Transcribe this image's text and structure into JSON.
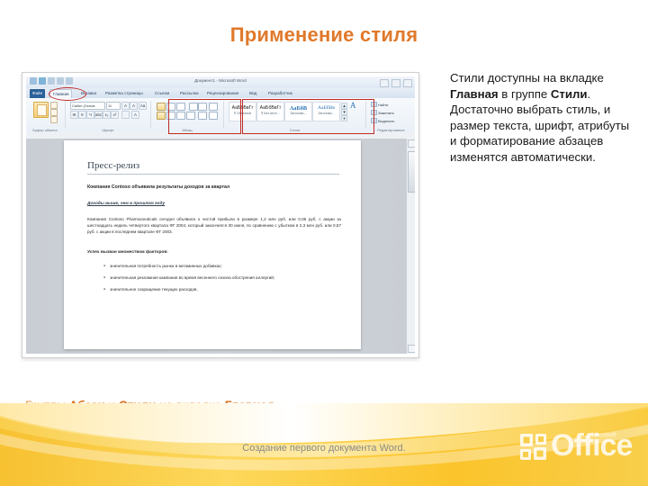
{
  "slide": {
    "title": "Применение стиля",
    "title_color": "#E0792B",
    "caption": {
      "parts": [
        {
          "text": "Группы ",
          "bold": false
        },
        {
          "text": "Абзац",
          "bold": true
        },
        {
          "text": " и ",
          "bold": false
        },
        {
          "text": "Стили",
          "bold": true
        },
        {
          "text": " на вкладке ",
          "bold": false
        },
        {
          "text": "Главная",
          "bold": true
        },
        {
          "text": ".",
          "bold": false
        }
      ],
      "color": "#E9A05A",
      "bold_color": "#D9701F"
    }
  },
  "explanation": {
    "parts": [
      {
        "text": "Стили доступны на вкладке ",
        "bold": false
      },
      {
        "text": "Главная",
        "bold": true
      },
      {
        "text": " в группе ",
        "bold": false
      },
      {
        "text": "Стили",
        "bold": true
      },
      {
        "text": ". Достаточно выбрать стиль, и размер текста, шрифт, атрибуты и форматирование абзацев изменятся автоматически.",
        "bold": false
      }
    ]
  },
  "screenshot": {
    "window": {
      "document_title": "Документ1 - Microsoft Word",
      "quick_access": [
        "save-icon",
        "undo-icon",
        "redo-icon",
        "customize-icon"
      ],
      "window_controls": [
        "minimize",
        "restore",
        "close"
      ]
    },
    "ribbon": {
      "tabs": [
        {
          "label": "Файл",
          "state": "file"
        },
        {
          "label": "Главная",
          "state": "active"
        },
        {
          "label": "Вставка",
          "state": "normal"
        },
        {
          "label": "Разметка страницы",
          "state": "normal"
        },
        {
          "label": "Ссылки",
          "state": "normal"
        },
        {
          "label": "Рассылки",
          "state": "normal"
        },
        {
          "label": "Рецензирование",
          "state": "normal"
        },
        {
          "label": "Вид",
          "state": "normal"
        },
        {
          "label": "Разработчик",
          "state": "normal"
        }
      ],
      "groups": [
        {
          "name": "Буфер обмена",
          "label": "Буфер обмена"
        },
        {
          "name": "Шрифт",
          "label": "Шрифт"
        },
        {
          "name": "Абзац",
          "label": "Абзац"
        },
        {
          "name": "Стили",
          "label": "Стили"
        },
        {
          "name": "Редактирование",
          "label": "Редактирование"
        }
      ],
      "clipboard": {
        "paste_label": "Вставить"
      },
      "font": {
        "font_name": "Calibri (Основ",
        "font_size": "11",
        "buttons": [
          "Ж",
          "К",
          "Ч",
          "abc",
          "x₂",
          "x²",
          "A",
          "A"
        ]
      },
      "styles_gallery": [
        {
          "sample": "АаБбВвГг",
          "name": "¶ Обычный",
          "kind": "n"
        },
        {
          "sample": "АаБбВвГг",
          "name": "¶ Без инте...",
          "kind": "n"
        },
        {
          "sample": "АаБбВ",
          "name": "Заголово...",
          "kind": "h1"
        },
        {
          "sample": "АаБбВв",
          "name": "Заголово...",
          "kind": "h2"
        }
      ],
      "change_styles": "Изменить стили",
      "editing": [
        "Найти",
        "Заменить",
        "Выделить"
      ]
    },
    "document": {
      "heading": "Пресс-релиз",
      "subtitle": "Компания Contoso объявила результаты доходов за квартал",
      "section_heading": "Доходы выше, чем в прошлом году",
      "body": "Компания Contoso Pharmaceuticals сегодня объявила о чистой прибыли в размере 1,2 млн руб. или 0,06 руб. с акции за шестнадцать недель четвертого квартала ФГ 2004, который закончился 30 июня, по сравнению с убытком в 2,3 млн руб. или 0,57 руб. с акции в последнем квартале ФГ 2003.",
      "lead_in": "Успех вызван множеством факторов:",
      "bullets": [
        "значительная потребность рынка в витаминных добавках;",
        "значительная рекламная кампания во время весеннего сезона обострения аллергий;",
        "значительное сокращение текущих расходов."
      ]
    },
    "annotations": {
      "color": "#C02A25",
      "items": [
        {
          "shape": "ellipse",
          "target": "home-tab"
        },
        {
          "shape": "rect",
          "target": "paragraph-group"
        },
        {
          "shape": "rect",
          "target": "styles-group"
        }
      ]
    }
  },
  "footer": {
    "text": "Создание первого документа Word.",
    "logo": {
      "brand": "Office",
      "microsoft": "Microsoft"
    }
  }
}
